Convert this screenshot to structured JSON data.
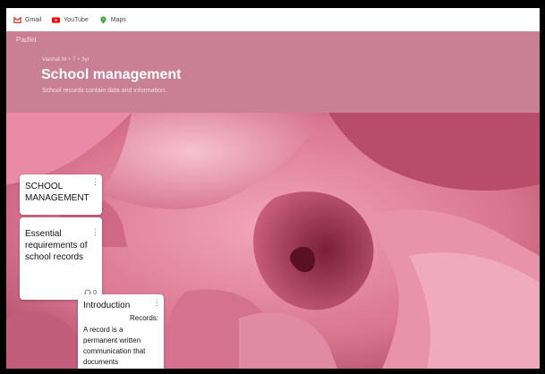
{
  "bookmarks": [
    {
      "label": "Gmail",
      "icon": "gmail-icon",
      "color": "#d93025"
    },
    {
      "label": "YouTube",
      "icon": "youtube-icon",
      "color": "#ff0000"
    },
    {
      "label": "Maps",
      "icon": "maps-icon",
      "color": "#34a853"
    }
  ],
  "header": {
    "logo": "Padlet",
    "breadcrumb": "Vaishali M + 7 + 3yr",
    "title": "School management",
    "subtitle": "School records contain data and information."
  },
  "cards": {
    "school_management": {
      "text": "SCHOOL MANAGEMENT"
    },
    "essential": {
      "text": "Essential requirements of school records",
      "comment_count": "0"
    },
    "introduction": {
      "title": "Introduction",
      "label": "Records:",
      "body": "A record is a permanent written communication that documents"
    }
  },
  "colors": {
    "header_bg": "#c97f95",
    "accent": "#e86f8e"
  }
}
